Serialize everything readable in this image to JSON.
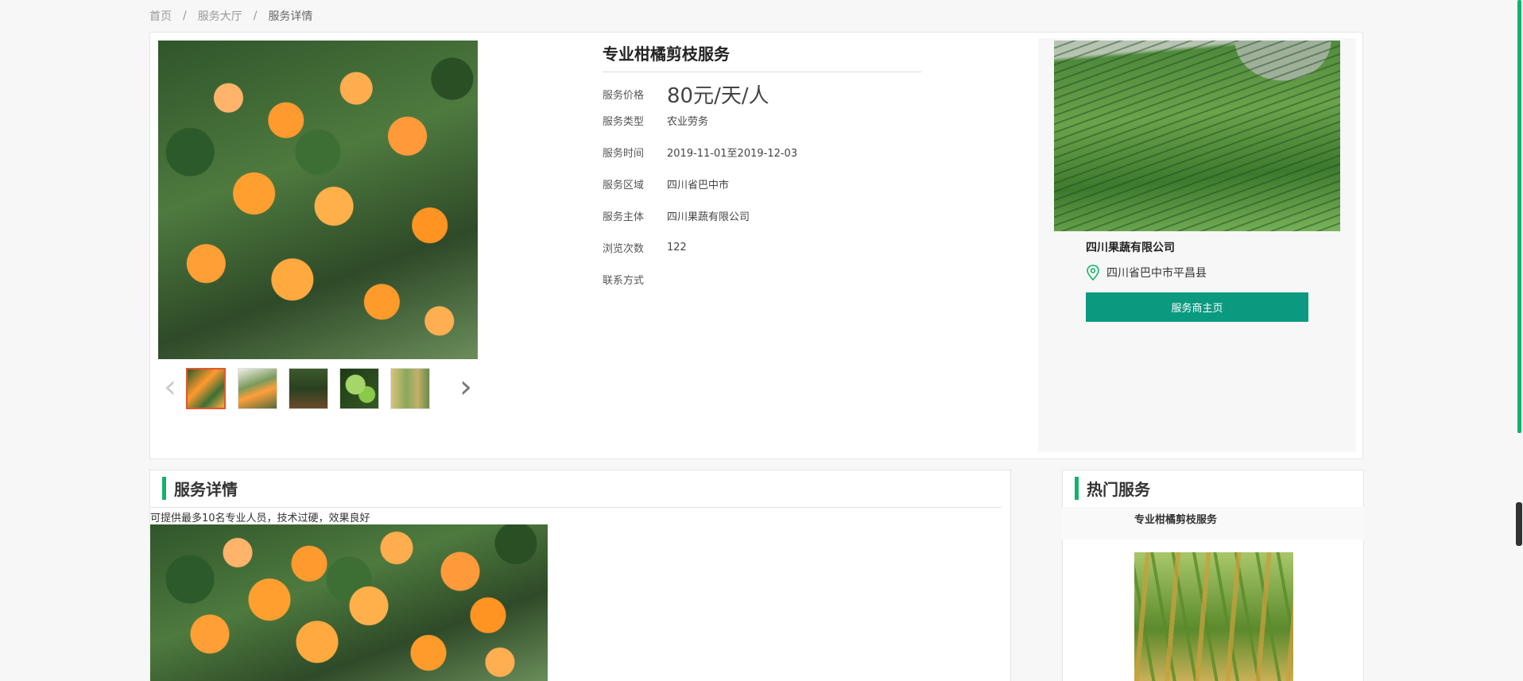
{
  "breadcrumb": {
    "home": "首页",
    "hall": "服务大厅",
    "current": "服务详情",
    "sep": "/"
  },
  "service": {
    "title": "专业柑橘剪枝服务",
    "rows": [
      {
        "label": "服务价格",
        "value": "80元/天/人"
      },
      {
        "label": "服务类型",
        "value": "农业劳务"
      },
      {
        "label": "服务时间",
        "value": "2019-11-01至2019-12-03"
      },
      {
        "label": "服务区域",
        "value": "四川省巴中市"
      },
      {
        "label": "服务主体",
        "value": "四川果蔬有限公司"
      },
      {
        "label": "浏览次数",
        "value": "122"
      },
      {
        "label": "联系方式",
        "value": ""
      }
    ],
    "price_color": "#13b26a"
  },
  "provider": {
    "name": "四川果蔬有限公司",
    "address": "四川省巴中市平昌县",
    "button_label": "服务商主页",
    "button_color": "#0b9a80"
  },
  "gallery": {
    "prev_icon": "‹",
    "next_icon": "›",
    "thumb_count": 5,
    "active_index": 0
  },
  "detail": {
    "heading": "服务详情",
    "text": "可提供最多10名专业人员，技术过硬，效果良好"
  },
  "hot": {
    "heading": "热门服务",
    "items": [
      {
        "title": "专业柑橘剪枝服务"
      }
    ]
  },
  "colors": {
    "accent": "#13b26a",
    "thumb_active_border": "#e2572b"
  }
}
